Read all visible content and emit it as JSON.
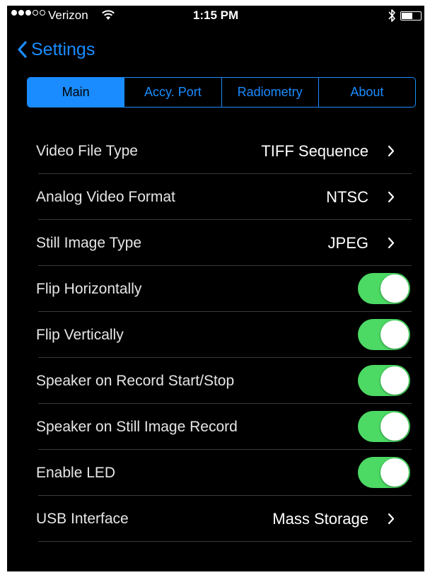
{
  "status_bar": {
    "carrier": "Verizon",
    "time": "1:15 PM",
    "signal_bars_filled": 3,
    "signal_bars_total": 5,
    "battery_level": 0.55
  },
  "nav": {
    "back_label": "Settings",
    "back_icon": "chevron-left-icon"
  },
  "colors": {
    "accent": "#1a8cff",
    "toggle_on": "#4cd964",
    "background": "#000000"
  },
  "tabs": [
    {
      "label": "Main",
      "selected": true
    },
    {
      "label": "Accy. Port",
      "selected": false
    },
    {
      "label": "Radiometry",
      "selected": false
    },
    {
      "label": "About",
      "selected": false
    }
  ],
  "settings": [
    {
      "label": "Video File Type",
      "value": "TIFF Sequence"
    },
    {
      "label": "Analog Video Format",
      "value": "NTSC"
    },
    {
      "label": "Still Image Type",
      "value": "JPEG"
    },
    {
      "label": "Flip Horizontally",
      "on": true
    },
    {
      "label": "Flip Vertically",
      "on": true
    },
    {
      "label": "Speaker on Record Start/Stop",
      "on": true
    },
    {
      "label": "Speaker on Still Image Record",
      "on": true
    },
    {
      "label": "Enable LED",
      "on": true
    },
    {
      "label": "USB Interface",
      "value": "Mass Storage"
    }
  ]
}
